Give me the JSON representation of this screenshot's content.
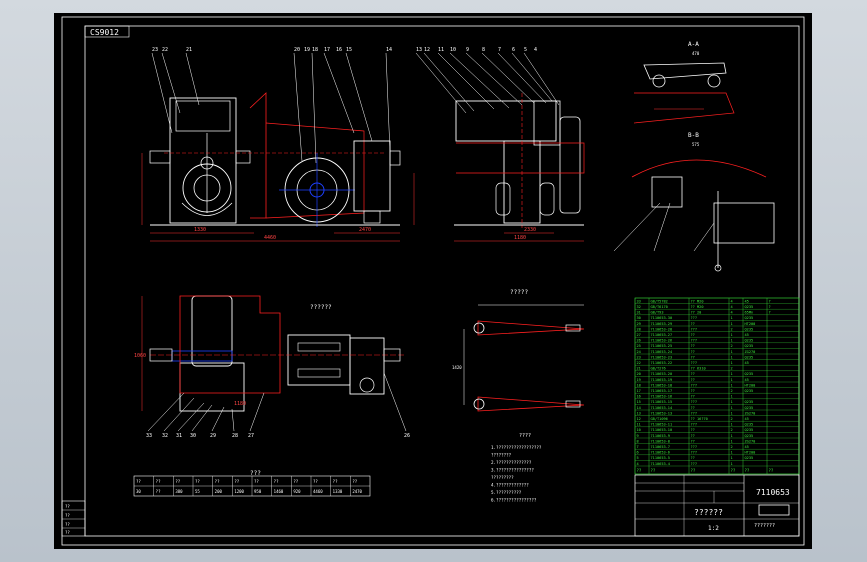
{
  "drawing": {
    "code_box": "CS9012",
    "section_a_label": "A-A",
    "section_b_label": "B-B",
    "view_label_top": "??????",
    "view_label_right": "?????",
    "table_title": "???",
    "tech_req_title": "????",
    "drawing_number": "7110653",
    "drawing_title": "??????",
    "scale": "1:2",
    "company": "???????",
    "section_a_dim": "470",
    "section_b_dim": "575",
    "front_dims": [
      "4460",
      "1330",
      "2470"
    ],
    "side_dims": [
      "1180",
      "2330"
    ],
    "plan_dims": [
      "1060",
      "1180"
    ],
    "rail_dim": "1420"
  },
  "balloons_top": [
    "23",
    "22",
    "21",
    "20",
    "19",
    "18",
    "17",
    "16",
    "15",
    "14",
    "13",
    "12",
    "11",
    "10",
    "9",
    "8",
    "7",
    "6",
    "5",
    "4"
  ],
  "balloons_bottom": [
    "33",
    "32",
    "31",
    "30",
    "29",
    "28",
    "27",
    "26"
  ],
  "parts_list": {
    "rows": [
      [
        "33",
        "GB/T5782",
        "?? M20",
        "4",
        "45",
        "?"
      ],
      [
        "32",
        "GB/T6170",
        "?? M20",
        "4",
        "Q235",
        "?"
      ],
      [
        "31",
        "GB/T93",
        "?? 20",
        "4",
        "65Mn",
        "?"
      ],
      [
        "30",
        "7110653-30",
        "???",
        "1",
        "Q235",
        ""
      ],
      [
        "29",
        "7110653-29",
        "??",
        "1",
        "HT200",
        ""
      ],
      [
        "28",
        "7110653-28",
        "???",
        "2",
        "Q235",
        ""
      ],
      [
        "27",
        "7110653-27",
        "??",
        "1",
        "45",
        ""
      ],
      [
        "26",
        "7110653-26",
        "???",
        "1",
        "Q235",
        ""
      ],
      [
        "25",
        "7110653-25",
        "??",
        "2",
        "Q235",
        ""
      ],
      [
        "24",
        "7110653-24",
        "??",
        "1",
        "ZG270",
        ""
      ],
      [
        "23",
        "7110653-23",
        "??",
        "1",
        "Q235",
        ""
      ],
      [
        "22",
        "7110653-22",
        "???",
        "1",
        "45",
        ""
      ],
      [
        "21",
        "GB/T276",
        "?? 6310",
        "2",
        "",
        ""
      ],
      [
        "20",
        "7110653-20",
        "??",
        "1",
        "Q235",
        ""
      ],
      [
        "19",
        "7110653-19",
        "??",
        "1",
        "45",
        ""
      ],
      [
        "18",
        "7110653-18",
        "???",
        "1",
        "HT200",
        ""
      ],
      [
        "17",
        "7110653-17",
        "??",
        "2",
        "Q235",
        ""
      ],
      [
        "16",
        "7110653-16",
        "??",
        "1",
        "",
        ""
      ],
      [
        "15",
        "7110653-15",
        "???",
        "1",
        "Q235",
        ""
      ],
      [
        "14",
        "7110653-14",
        "??",
        "1",
        "Q235",
        ""
      ],
      [
        "13",
        "7110653-13",
        "???",
        "1",
        "ZG270",
        ""
      ],
      [
        "12",
        "GB/T1096",
        "?? 16?70",
        "2",
        "45",
        ""
      ],
      [
        "11",
        "7110653-11",
        "???",
        "1",
        "Q235",
        ""
      ],
      [
        "10",
        "7110653-10",
        "??",
        "2",
        "Q235",
        ""
      ],
      [
        "9",
        "7110653-9",
        "??",
        "1",
        "Q235",
        ""
      ],
      [
        "8",
        "7110653-8",
        "??",
        "1",
        "ZG270",
        ""
      ],
      [
        "7",
        "7110653-7",
        "???",
        "2",
        "45",
        ""
      ],
      [
        "6",
        "7110653-6",
        "???",
        "1",
        "HT200",
        ""
      ],
      [
        "5",
        "7110653-5",
        "??",
        "1",
        "Q235",
        ""
      ],
      [
        "4",
        "7110653-4",
        "???",
        "1",
        "",
        ""
      ]
    ],
    "header": [
      "??",
      "??",
      "??",
      "??",
      "??",
      "??"
    ]
  },
  "bottom_table": {
    "header": [
      "??",
      "??",
      "??",
      "??",
      "??",
      "??",
      "??",
      "??",
      "??",
      "??",
      "??",
      "??"
    ],
    "row": [
      "30",
      "??",
      "380",
      "55",
      "200",
      "1200",
      "950",
      "1460",
      "920",
      "4460",
      "1330",
      "2470"
    ]
  },
  "tech_notes": [
    "1.??????????????????",
    "  ????????",
    "2.??????????????",
    "3.???????????????",
    "  ?????????",
    "4.?????????????",
    "5.??????????",
    "6.????????????????"
  ],
  "title_block": {
    "left_labels": [
      "??",
      "??",
      "??",
      "??"
    ]
  },
  "colors": {
    "outline": "#ffffff",
    "hidden": "#ff2020",
    "dimension": "#ff3030",
    "table": "#3cf03c",
    "accent_blue": "#1e40ff",
    "text_green": "#3cf03c"
  }
}
